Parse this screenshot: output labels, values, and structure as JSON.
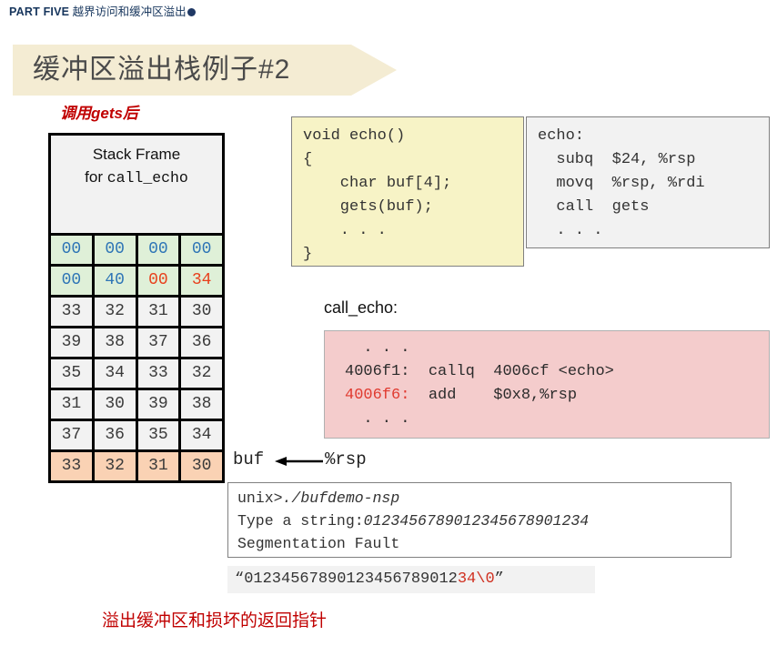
{
  "header": {
    "part_label": "PART FIVE",
    "topic": "越界访问和缓冲区溢出",
    "bullet_icon": "filled-circle-icon"
  },
  "title": {
    "text": "缓冲区溢出栈例子#2",
    "banner_color": "#f4ecd3",
    "text_color": "#4a4a4a"
  },
  "annotations": {
    "after_gets": "调用gets后",
    "bottom_caption": "溢出缓冲区和损坏的返回指针",
    "accent_red": "#c00000"
  },
  "stack_frame": {
    "title_line1": "Stack Frame",
    "title_line2_prefix": "for ",
    "title_line2_mono": "call_echo",
    "rows": [
      {
        "style": "green",
        "cells": [
          {
            "text": "00",
            "ink": "blue"
          },
          {
            "text": "00",
            "ink": "blue"
          },
          {
            "text": "00",
            "ink": "blue"
          },
          {
            "text": "00",
            "ink": "blue"
          }
        ]
      },
      {
        "style": "green",
        "cells": [
          {
            "text": "00",
            "ink": "blue"
          },
          {
            "text": "40",
            "ink": "blue"
          },
          {
            "text": "00",
            "ink": "red"
          },
          {
            "text": "34",
            "ink": "red"
          }
        ]
      },
      {
        "style": "plain",
        "cells": [
          {
            "text": "33",
            "ink": "dark"
          },
          {
            "text": "32",
            "ink": "dark"
          },
          {
            "text": "31",
            "ink": "dark"
          },
          {
            "text": "30",
            "ink": "dark"
          }
        ]
      },
      {
        "style": "plain",
        "cells": [
          {
            "text": "39",
            "ink": "dark"
          },
          {
            "text": "38",
            "ink": "dark"
          },
          {
            "text": "37",
            "ink": "dark"
          },
          {
            "text": "36",
            "ink": "dark"
          }
        ]
      },
      {
        "style": "plain",
        "cells": [
          {
            "text": "35",
            "ink": "dark"
          },
          {
            "text": "34",
            "ink": "dark"
          },
          {
            "text": "33",
            "ink": "dark"
          },
          {
            "text": "32",
            "ink": "dark"
          }
        ]
      },
      {
        "style": "plain",
        "cells": [
          {
            "text": "31",
            "ink": "dark"
          },
          {
            "text": "30",
            "ink": "dark"
          },
          {
            "text": "39",
            "ink": "dark"
          },
          {
            "text": "38",
            "ink": "dark"
          }
        ]
      },
      {
        "style": "plain",
        "cells": [
          {
            "text": "37",
            "ink": "dark"
          },
          {
            "text": "36",
            "ink": "dark"
          },
          {
            "text": "35",
            "ink": "dark"
          },
          {
            "text": "34",
            "ink": "dark"
          }
        ]
      },
      {
        "style": "orange",
        "cells": [
          {
            "text": "33",
            "ink": "dark"
          },
          {
            "text": "32",
            "ink": "dark"
          },
          {
            "text": "31",
            "ink": "dark"
          },
          {
            "text": "30",
            "ink": "dark"
          }
        ]
      }
    ],
    "colors": {
      "green": "#dff0d8",
      "orange": "#fad2b4",
      "plain": "#f2f2f2",
      "blue_ink": "#2e75b6",
      "red_ink": "#e8401c"
    }
  },
  "pointer": {
    "buf_label": "buf",
    "rsp_label": "%rsp",
    "arrow_icon": "left-arrow-icon"
  },
  "c_code": {
    "background": "#f7f3c6",
    "lines": [
      "void echo()",
      "{",
      "    char buf[4];",
      "    gets(buf);",
      "    . . .",
      "}"
    ]
  },
  "asm_echo": {
    "background": "#f2f2f2",
    "lines": [
      "echo:",
      "  subq  $24, %rsp",
      "  movq  %rsp, %rdi",
      "  call  gets",
      "  . . ."
    ]
  },
  "call_echo": {
    "label": "call_echo:",
    "background": "#f4cccc",
    "lines": [
      {
        "text": "  . . .",
        "addr": "",
        "highlight": false
      },
      {
        "addr": "4006f1:",
        "text": "  callq  4006cf <echo>",
        "highlight": false
      },
      {
        "addr": "4006f6:",
        "text": "  add    $0x8,%rsp",
        "highlight": true
      },
      {
        "addr": "",
        "text": "  . . .",
        "highlight": false
      }
    ]
  },
  "terminal": {
    "line1_prompt": "unix>",
    "line1_typed": "./bufdemo-nsp",
    "line2_prompt": "Type a string:",
    "line2_typed": "0123456789012345678901234",
    "line3": "Segmentation Fault"
  },
  "string_strip": {
    "open_quote": "“",
    "black_part": "01234567890123456789012",
    "red_part": "34\\0",
    "close_quote": "”",
    "red_color": "#d03020"
  }
}
